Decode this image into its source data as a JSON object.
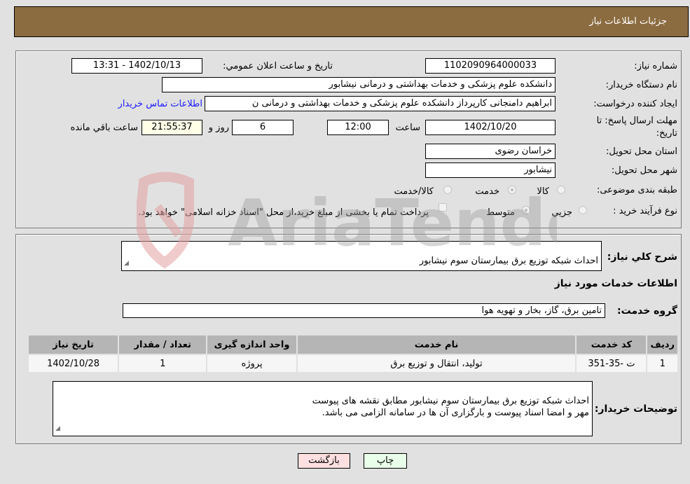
{
  "header": {
    "title": "جزئیات اطلاعات نیاز"
  },
  "form": {
    "need_number": {
      "label": "شماره نیاز:",
      "value": "1102090964000033"
    },
    "announce_datetime": {
      "label": "تاریخ و ساعت اعلان عمومي:",
      "value": "1402/10/13 - 13:31"
    },
    "buyer_org": {
      "label": "نام دستگاه خريدار:",
      "value": "دانشکده علوم پزشکی و خدمات بهداشتی و درمانی نیشابور"
    },
    "requester": {
      "label": "ايجاد کننده درخواست:",
      "value": "ابراهیم دامنجانی  کارپرداز دانشکده علوم پزشکی و خدمات بهداشتی و درمانی ن",
      "contact_link": "اطلاعات تماس خريدار"
    },
    "deadline": {
      "label_line1": "مهلت ارسال پاسخ: تا",
      "label_line2": "تاريخ:",
      "date": "1402/10/20",
      "time_label": "ساعت",
      "time": "12:00",
      "days": "6",
      "days_label": "روز و",
      "remaining": "21:55:37",
      "remaining_label": "ساعت باقي مانده"
    },
    "province": {
      "label": "استان محل تحويل:",
      "value": "خراسان رضوی"
    },
    "city": {
      "label": "شهر محل تحويل:",
      "value": "نیشابور"
    },
    "category": {
      "label": "طبقه بندی موضوعی:",
      "options": [
        {
          "label": "کالا",
          "checked": false
        },
        {
          "label": "خدمت",
          "checked": true
        },
        {
          "label": "کالا/خدمت",
          "checked": false
        }
      ]
    },
    "purchase_type": {
      "label": "نوع فرآيند خريد :",
      "options": [
        {
          "label": "جزيي",
          "checked": false
        },
        {
          "label": "متوسط",
          "checked": true
        }
      ],
      "treasury_note": "پرداخت تمام يا بخشی از مبلغ خريد،از محل \"اسناد خزانه اسلامی\" خواهد بود."
    }
  },
  "description": {
    "label": "شرح کلي نياز:",
    "value": "احداث شبکه توزیع برق بیمارستان سوم نیشابور"
  },
  "services": {
    "section_title": "اطلاعات خدمات مورد نياز",
    "group_label": "گروه خدمت:",
    "group_value": "تامین برق، گاز، بخار و تهویه هوا",
    "table": {
      "headers": [
        "رديف",
        "کد خدمت",
        "نام خدمت",
        "واحد اندازه گيری",
        "تعداد / مقدار",
        "تاريخ نياز"
      ],
      "rows": [
        [
          "1",
          "ت -35-351",
          "تولید، انتقال و توزیع برق",
          "پروژه",
          "1",
          "1402/10/28"
        ]
      ]
    }
  },
  "buyer_notes": {
    "label": "توضيحات خريدار:",
    "value": "احداث شبکه توزیع برق بیمارستان سوم نیشابور مطابق نقشه های پیوست\nمهر و امضا اسناد پیوست و بارگزاری آن ها در سامانه الزامی می باشد."
  },
  "buttons": {
    "print": "چاپ",
    "back": "بازگشت"
  },
  "colors": {
    "header": "#8b6b40",
    "print_bg": "#eaffea",
    "back_bg": "#ffe0e0",
    "link": "#1a1aff",
    "remaining_bg": "#ffffe8"
  }
}
